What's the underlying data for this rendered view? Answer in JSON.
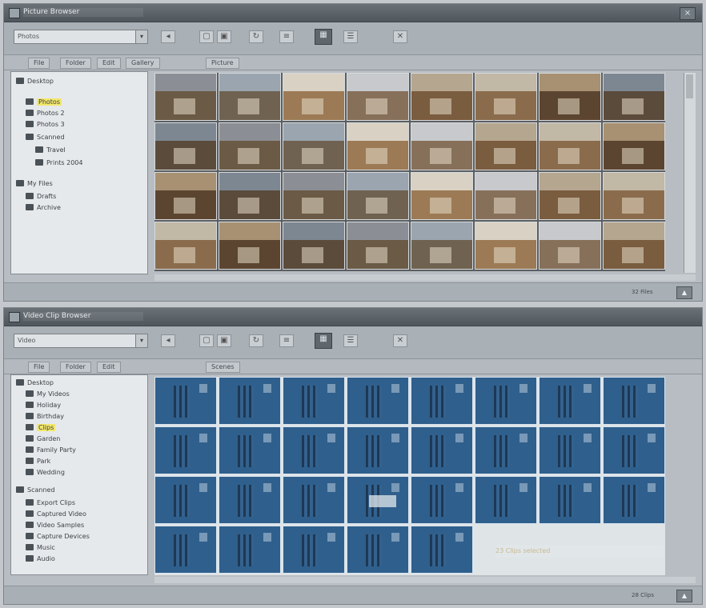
{
  "colors": {
    "window_bg": "#b7bdc2",
    "title_bg": "#5c646a",
    "tree_bg": "#e6e9ec",
    "selection_yellow": "#f2e76b",
    "thumb_blue": "#2f5f8c",
    "accent_active": "#5f676d"
  },
  "window1": {
    "title": "Picture Browser",
    "icons": {
      "app": "app-icon",
      "close": "close-icon"
    },
    "combo": {
      "value": "Photos"
    },
    "toolbar_icons": [
      "back-icon",
      "forward-icon",
      "copy-icon",
      "paste-icon",
      "separator",
      "rotate-icon",
      "view-thumbnails-icon",
      "view-list-icon",
      "delete-icon"
    ],
    "tabs": [
      "File",
      "Folder",
      "Edit",
      "Gallery",
      "Picture"
    ],
    "tree": [
      {
        "label": "Desktop",
        "level": 0
      },
      {
        "label": "Photos",
        "level": 1,
        "selected": true
      },
      {
        "label": "Photos 2",
        "level": 1
      },
      {
        "label": "Photos 3",
        "level": 1
      },
      {
        "label": "Scanned",
        "level": 1
      },
      {
        "label": "Travel",
        "level": 2
      },
      {
        "label": "Prints 2004",
        "level": 2
      },
      {
        "label": "My Files",
        "level": 0
      },
      {
        "label": "Drafts",
        "level": 1
      },
      {
        "label": "Archive",
        "level": 1
      }
    ],
    "status": {
      "text": "32 Files",
      "button": "▲"
    }
  },
  "window2": {
    "title": "Video Clip Browser",
    "icons": {
      "app": "app-icon",
      "close": "close-icon"
    },
    "combo": {
      "value": "Video"
    },
    "tabs": [
      "File",
      "Folder",
      "Edit",
      "Scenes"
    ],
    "tree": [
      {
        "label": "Desktop",
        "level": 0
      },
      {
        "label": "My Videos",
        "level": 1
      },
      {
        "label": "Holiday",
        "level": 1
      },
      {
        "label": "Birthday",
        "level": 1
      },
      {
        "label": "Clips",
        "level": 1,
        "selected": true
      },
      {
        "label": "Garden",
        "level": 1
      },
      {
        "label": "Family Party",
        "level": 1
      },
      {
        "label": "Park",
        "level": 1
      },
      {
        "label": "Wedding",
        "level": 1
      },
      {
        "label": "Scanned",
        "level": 0
      },
      {
        "label": "Export Clips",
        "level": 1
      },
      {
        "label": "Captured Video",
        "level": 1
      },
      {
        "label": "Video Samples",
        "level": 1
      },
      {
        "label": "Capture Devices",
        "level": 1
      },
      {
        "label": "Music",
        "level": 1
      },
      {
        "label": "Audio",
        "level": 1
      }
    ],
    "selection_text": "23 Clips selected",
    "status": {
      "text": "28 Clips",
      "button": "▲"
    }
  }
}
